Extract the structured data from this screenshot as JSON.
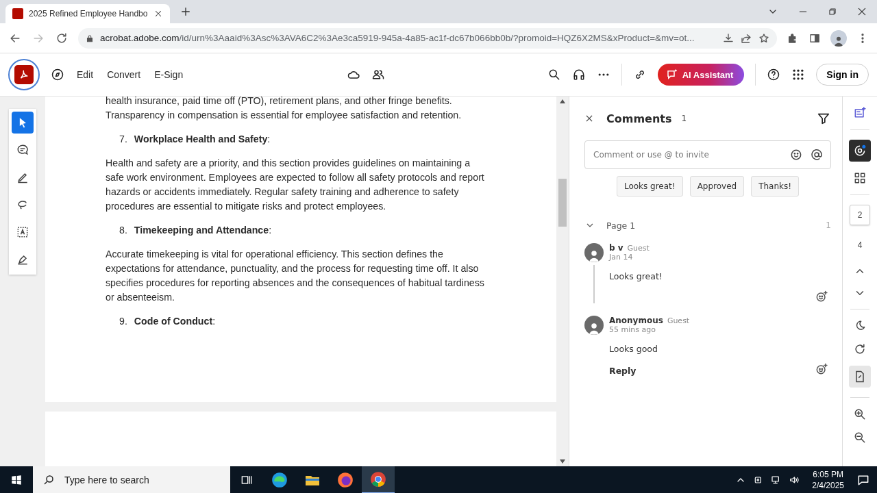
{
  "browser": {
    "tab": {
      "title": "2025 Refined Employee Handbo",
      "selected": true
    },
    "url_host": "acrobat.adobe.com",
    "url_path": "/id/urn%3Aaaid%3Asc%3AVA6C2%3Ae3ca5919-945a-4a85-ac1f-dc67b066bb0b/?promoid=HQZ6X2MS&xProduct=&mv=ot..."
  },
  "toolbar": {
    "menu": [
      "Edit",
      "Convert",
      "E-Sign"
    ],
    "ai_button": "AI Assistant",
    "sign_in": "Sign in"
  },
  "tools": [
    {
      "kind": "select",
      "selected": true
    },
    {
      "kind": "comment",
      "selected": false
    },
    {
      "kind": "draw",
      "selected": false
    },
    {
      "kind": "lasso",
      "selected": false
    },
    {
      "kind": "text",
      "selected": false
    },
    {
      "kind": "sign",
      "selected": false
    }
  ],
  "document": [
    {
      "kind": "paragraph",
      "text": "health insurance, paid time off (PTO), retirement plans, and other fringe benefits. Transparency in compensation is essential for employee satisfaction and retention."
    },
    {
      "kind": "heading",
      "number": "7.",
      "text": "Workplace Health and Safety",
      "suffix": ":"
    },
    {
      "kind": "paragraph",
      "text": "Health and safety are a priority, and this section provides guidelines on maintaining a safe work environment. Employees are expected to follow all safety protocols and report hazards or accidents immediately. Regular safety training and adherence to safety procedures are essential to mitigate risks and protect employees."
    },
    {
      "kind": "heading",
      "number": "8.",
      "text": "Timekeeping and Attendance",
      "suffix": ":"
    },
    {
      "kind": "paragraph",
      "text": "Accurate timekeeping is vital for operational efficiency. This section defines the expectations for attendance, punctuality, and the process for requesting time off. It also specifies procedures for reporting absences and the consequences of habitual tardiness or absenteeism."
    },
    {
      "kind": "heading",
      "number": "9.",
      "text": "Code of Conduct",
      "suffix": ":"
    }
  ],
  "comments": {
    "title": "Comments",
    "count": "1",
    "placeholder": "Comment or use @ to invite",
    "quick_replies": [
      "Looks great!",
      "Approved",
      "Thanks!"
    ],
    "group": {
      "label": "Page 1",
      "count": "1",
      "expanded": true
    },
    "items": [
      {
        "author": "b v",
        "role": "Guest",
        "time": "Jan 14",
        "text": "Looks great!"
      },
      {
        "author": "Anonymous",
        "role": "Guest",
        "time": "55 mins ago",
        "text": "Looks good",
        "reply": "Reply"
      }
    ]
  },
  "rail": {
    "pages": [
      {
        "label": "2",
        "selected": true
      },
      {
        "label": "4",
        "selected": false
      }
    ]
  },
  "taskbar": {
    "search_placeholder": "Type here to search",
    "time": "6:05 PM",
    "date": "2/4/2025"
  }
}
